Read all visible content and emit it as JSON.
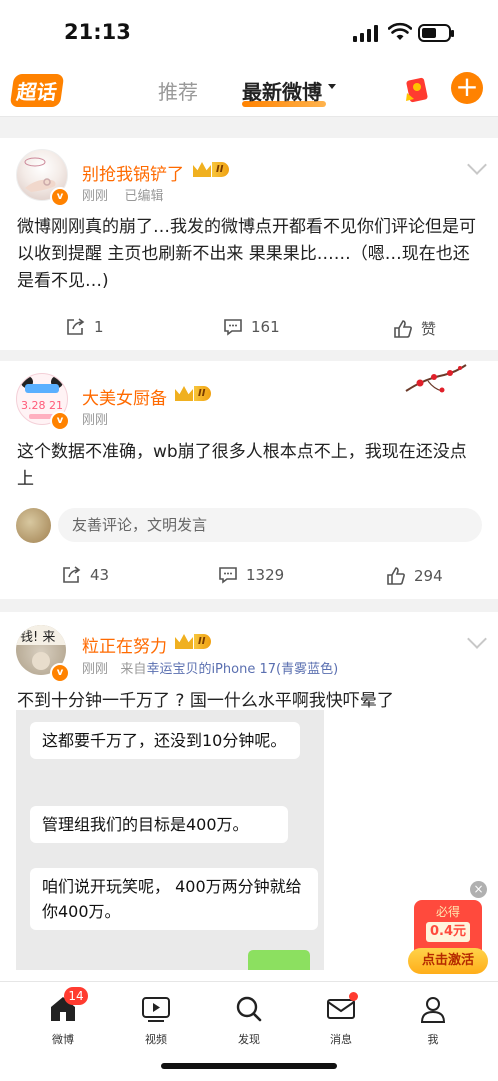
{
  "status": {
    "time": "21:13",
    "battery_level": 0.55
  },
  "nav": {
    "chaohua": "超话",
    "tab_recommend": "推荐",
    "tab_latest": "最新微博"
  },
  "posts": [
    {
      "user": "别抢我锅铲了",
      "level": "II",
      "meta_time": "刚刚",
      "meta_extra": "已编辑",
      "text": "微博刚刚真的崩了…我发的微博点开都看不见你们评论但是可以收到提醒  主页也刷新不出来 果果果比……（嗯…现在也还是看不见…)",
      "reposts": "1",
      "comments": "161",
      "likes": "赞"
    },
    {
      "user": "大美女厨备",
      "level": "II",
      "meta_time": "刚刚",
      "text": "这个数据不准确，wb崩了很多人根本点不上，我现在还没点上",
      "comment_placeholder": "友善评论，文明发言",
      "reposts": "43",
      "comments": "1329",
      "likes": "294"
    },
    {
      "user": "粒正在努力",
      "level": "II",
      "meta_time": "刚刚",
      "meta_from": "来自",
      "meta_source": "幸运宝贝的iPhone 17(青雾蓝色)",
      "text": "不到十分钟一千万了 ? 国一什么水平啊我快吓晕了",
      "chat_bubbles": [
        "这都要千万了，还没到10分钟呢。",
        "管理组我们的目标是400万。",
        "咱们说开玩笑呢， 400万两分钟就给你400万。"
      ]
    }
  ],
  "float_packet": {
    "top": "必得",
    "amount": "0.4元",
    "button": "点击激活"
  },
  "tabbar": {
    "home": "微博",
    "home_badge": "14",
    "video": "视频",
    "discover": "发现",
    "messages": "消息",
    "me": "我"
  }
}
